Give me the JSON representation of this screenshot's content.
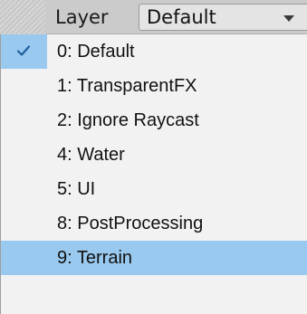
{
  "header": {
    "layer_label": "Layer",
    "dropdown_value": "Default",
    "dropdown_icon": "chevron-down-icon"
  },
  "menu": {
    "items": [
      {
        "label": "0: Default",
        "checked": true
      },
      {
        "label": "1: TransparentFX",
        "checked": false
      },
      {
        "label": "2: Ignore Raycast",
        "checked": false
      },
      {
        "label": "4: Water",
        "checked": false
      },
      {
        "label": "5: UI",
        "checked": false
      },
      {
        "label": "8: PostProcessing",
        "checked": false
      },
      {
        "label": "9: Terrain",
        "checked": false,
        "hovered": true
      }
    ]
  },
  "colors": {
    "highlight": "#99c9ef",
    "checkmark": "#1f5f9e",
    "menu_background": "#f2f2f2",
    "header_background": "#cbcbcb"
  }
}
